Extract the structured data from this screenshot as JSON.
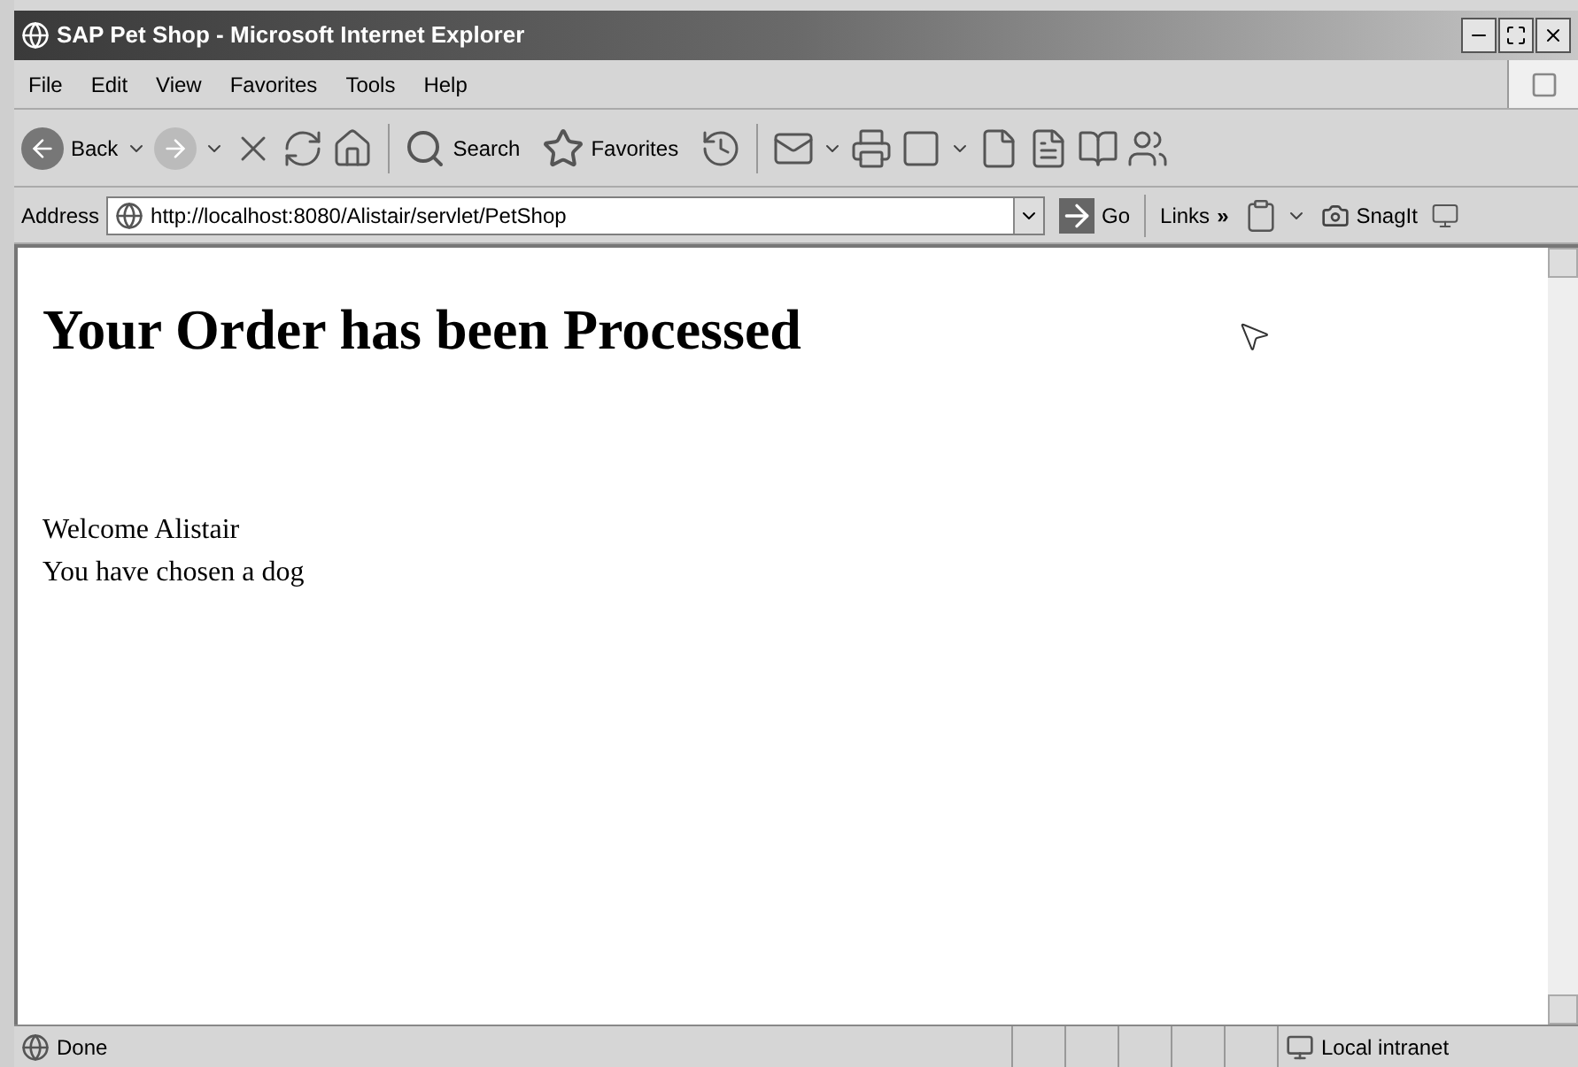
{
  "window": {
    "title": "SAP Pet Shop - Microsoft Internet Explorer"
  },
  "menu": [
    "File",
    "Edit",
    "View",
    "Favorites",
    "Tools",
    "Help"
  ],
  "toolbar": {
    "back": "Back",
    "search": "Search",
    "favorites": "Favorites"
  },
  "address_bar": {
    "label": "Address",
    "url": "http://localhost:8080/Alistair/servlet/PetShop",
    "go": "Go",
    "links": "Links",
    "links_more": "»",
    "snagit": "SnagIt"
  },
  "page": {
    "heading": "Your Order has been Processed",
    "lines": [
      "Welcome Alistair",
      "You have chosen a dog"
    ]
  },
  "status_bar": {
    "text": "Done",
    "zone": "Local intranet"
  }
}
